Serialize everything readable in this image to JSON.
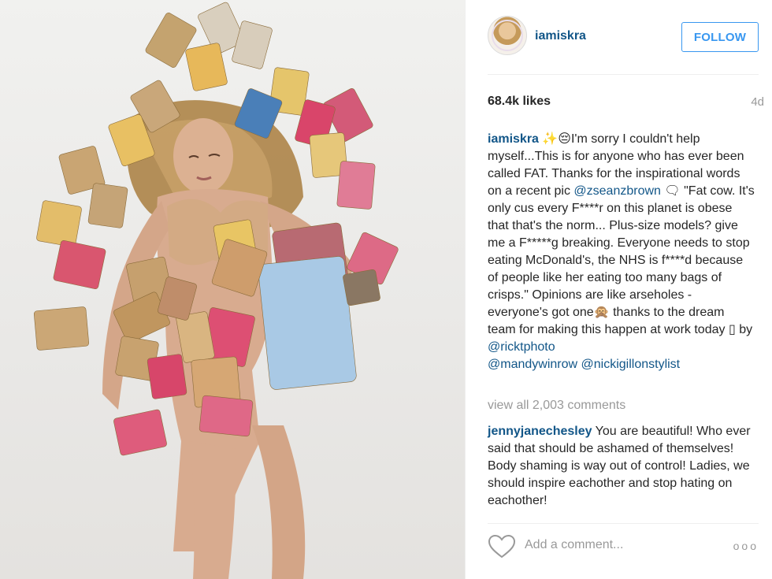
{
  "post": {
    "image": {
      "alt_icon": "photo",
      "colors": {
        "background": "#ecebe9",
        "hair": "#b08950",
        "skin": "#d8ab8f",
        "bra": "#d3aa84"
      }
    }
  },
  "header": {
    "username": "iamiskra",
    "follow_label": "FOLLOW",
    "accent_color": "#3897f0"
  },
  "stats": {
    "likes": "68.4k likes",
    "age": "4d"
  },
  "caption": {
    "username": "iamiskra",
    "emoji_lead": " ✨😔",
    "text_1": "I'm sorry I couldn't help myself...This is for anyone who has ever been called FAT. Thanks for the inspirational words on a recent pic ",
    "mention_1": "@zseanzbrown",
    "emoji_mid": " 🗨 ",
    "text_2": "\"Fat cow. It's only cus every F****r on this planet is obese that that's the norm... Plus-size models? give me a F*****g breaking. Everyone needs to stop eating McDonald's, the NHS is f****d because of people like her eating too many bags of crisps.\" Opinions are like arseholes - everyone's got one",
    "emoji_end": "🙊",
    "text_3": " thanks to the dream team for making this happen at work today ",
    "emoji_box": "▯",
    "text_4": " by ",
    "mention_2": "@ricktphoto",
    "mention_3": "@mandywinrow",
    "mention_4": "@nickigillonstylist"
  },
  "view_all": "view all 2,003 comments",
  "comment": {
    "username": "jennyjanechesley",
    "text": " You are beautiful! Who ever said that should be ashamed of themselves! Body shaming is way out of control! Ladies, we should inspire eachother and stop hating on eachother!"
  },
  "footer": {
    "add_comment_placeholder": "Add a comment...",
    "more_label": "ooo",
    "like_icon": "heart-outline-icon"
  }
}
